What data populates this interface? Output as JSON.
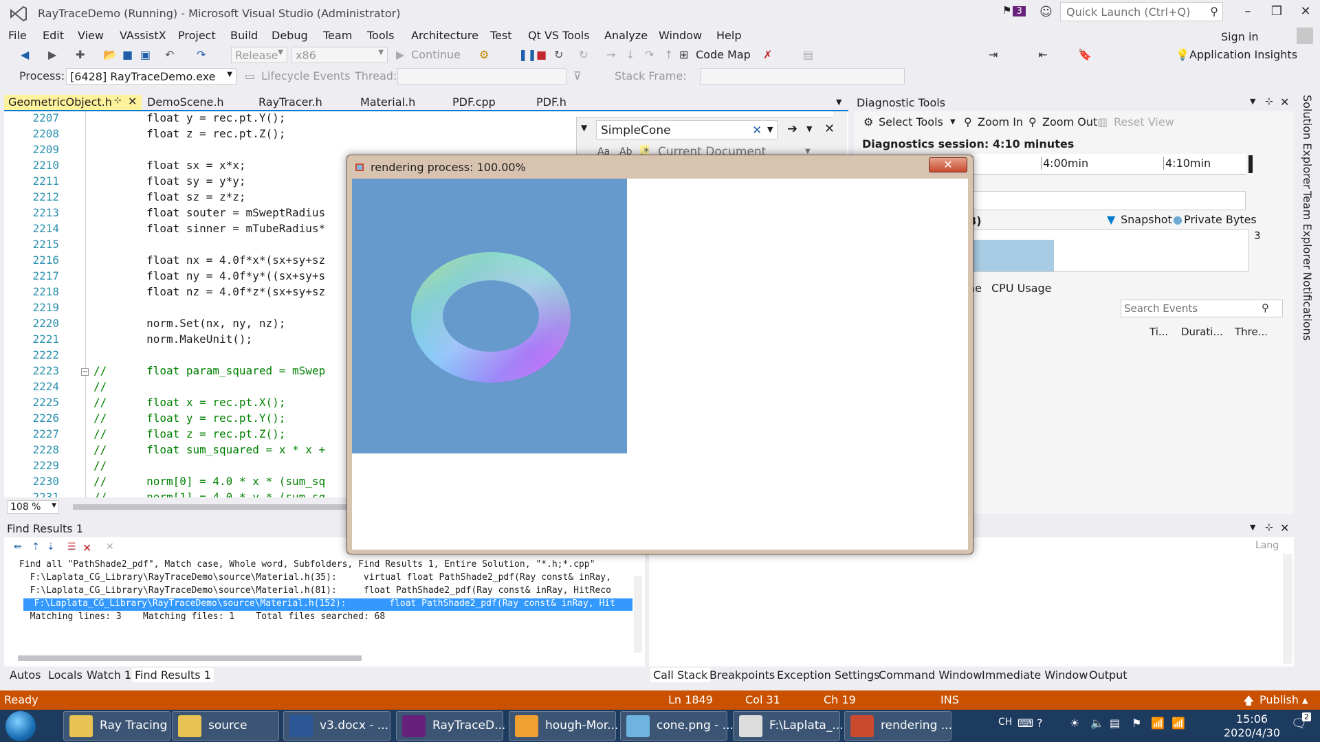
{
  "window": {
    "title": "RayTraceDemo (Running) - Microsoft Visual Studio (Administrator)",
    "notification_count": "3",
    "quick_launch_placeholder": "Quick Launch (Ctrl+Q)",
    "sign_in": "Sign in"
  },
  "menu": [
    "File",
    "Edit",
    "View",
    "VAssistX",
    "Project",
    "Build",
    "Debug",
    "Team",
    "Tools",
    "Architecture",
    "Test",
    "Qt VS Tools",
    "Analyze",
    "Window",
    "Help"
  ],
  "toolbar": {
    "config": "Release",
    "platform": "x86",
    "continue": "Continue",
    "code_map": "Code Map",
    "app_insights": "Application Insights"
  },
  "procbar": {
    "process_label": "Process:",
    "process_value": "[6428] RayTraceDemo.exe",
    "lifecycle": "Lifecycle Events",
    "thread": "Thread:",
    "stack_frame": "Stack Frame:"
  },
  "doc_tabs": [
    "GeometricObject.h",
    "DemoScene.h",
    "RayTracer.h",
    "Material.h",
    "PDF.cpp",
    "PDF.h"
  ],
  "find": {
    "query": "SimpleCone",
    "scope": "Current Document"
  },
  "code": [
    {
      "n": "2207",
      "t": "        float y = rec.pt.Y();",
      "c": false
    },
    {
      "n": "2208",
      "t": "        float z = rec.pt.Z();",
      "c": false
    },
    {
      "n": "2209",
      "t": "",
      "c": false
    },
    {
      "n": "2210",
      "t": "        float sx = x*x;",
      "c": false
    },
    {
      "n": "2211",
      "t": "        float sy = y*y;",
      "c": false
    },
    {
      "n": "2212",
      "t": "        float sz = z*z;",
      "c": false
    },
    {
      "n": "2213",
      "t": "        float souter = mSweptRadius",
      "c": false
    },
    {
      "n": "2214",
      "t": "        float sinner = mTubeRadius*",
      "c": false
    },
    {
      "n": "2215",
      "t": "",
      "c": false
    },
    {
      "n": "2216",
      "t": "        float nx = 4.0f*x*(sx+sy+sz",
      "c": false
    },
    {
      "n": "2217",
      "t": "        float ny = 4.0f*y*((sx+sy+s",
      "c": false
    },
    {
      "n": "2218",
      "t": "        float nz = 4.0f*z*(sx+sy+sz",
      "c": false
    },
    {
      "n": "2219",
      "t": "",
      "c": false
    },
    {
      "n": "2220",
      "t": "        norm.Set(nx, ny, nz);",
      "c": false
    },
    {
      "n": "2221",
      "t": "        norm.MakeUnit();",
      "c": false
    },
    {
      "n": "2222",
      "t": "",
      "c": false
    },
    {
      "n": "2223",
      "t": "//      float param_squared = mSwep",
      "c": true
    },
    {
      "n": "2224",
      "t": "//",
      "c": true
    },
    {
      "n": "2225",
      "t": "//      float x = rec.pt.X();",
      "c": true
    },
    {
      "n": "2226",
      "t": "//      float y = rec.pt.Y();",
      "c": true
    },
    {
      "n": "2227",
      "t": "//      float z = rec.pt.Z();",
      "c": true
    },
    {
      "n": "2228",
      "t": "//      float sum_squared = x * x +",
      "c": true
    },
    {
      "n": "2229",
      "t": "//",
      "c": true
    },
    {
      "n": "2230",
      "t": "//      norm[0] = 4.0 * x * (sum_sq",
      "c": true
    },
    {
      "n": "2231",
      "t": "//      norm[1] = 4.0 * y * (sum_sq",
      "c": true
    }
  ],
  "zoom": "108 %",
  "diagnostics": {
    "title": "Diagnostic Tools",
    "select_tools": "Select Tools",
    "zoom_in": "Zoom In",
    "zoom_out": "Zoom Out",
    "reset_view": "Reset View",
    "session": "Diagnostics session: 4:10 minutes",
    "tick1": "4:00min",
    "tick2": "4:10min",
    "mem_unit": "B)",
    "snapshot": "Snapshot",
    "private_bytes": "Private Bytes",
    "axis_max": "3",
    "events_tab": "ne",
    "cpu_tab": "CPU Usage",
    "search_events": "Search Events",
    "col_time": "Ti...",
    "col_duration": "Durati...",
    "col_thread": "Thre..."
  },
  "dialog": {
    "title": "rendering process: 100.00%",
    "close": "✕"
  },
  "find_results": {
    "title": "Find Results 1",
    "lines": [
      "Find all \"PathShade2_pdf\", Match case, Whole word, Subfolders, Find Results 1, Entire Solution, \"*.h;*.cpp\"",
      "  F:\\Laplata_CG_Library\\RayTraceDemo\\source\\Material.h(35):     virtual float PathShade2_pdf(Ray const& inRay,",
      "  F:\\Laplata_CG_Library\\RayTraceDemo\\source\\Material.h(81):     float PathShade2_pdf(Ray const& inRay, HitReco",
      "  F:\\Laplata_CG_Library\\RayTraceDemo\\source\\Material.h(152):        float PathShade2_pdf(Ray const& inRay, Hit",
      "  Matching lines: 3    Matching files: 1    Total files searched: 68"
    ]
  },
  "output_lang": "Lang",
  "bottom_tabs_left": [
    "Autos",
    "Locals",
    "Watch 1",
    "Find Results 1"
  ],
  "bottom_tabs_right": [
    "Call Stack",
    "Breakpoints",
    "Exception Settings",
    "Command Window",
    "Immediate Window",
    "Output"
  ],
  "side_tabs": [
    "Solution Explorer",
    "Team Explorer",
    "Notifications"
  ],
  "status": {
    "ready": "Ready",
    "ln": "Ln 1849",
    "col": "Col 31",
    "ch": "Ch 19",
    "ins": "INS",
    "publish": "Publish"
  },
  "taskbar": [
    {
      "label": "Ray Tracing",
      "icon": "folder-icon"
    },
    {
      "label": "source",
      "icon": "folder-icon"
    },
    {
      "label": "v3.docx - ...",
      "icon": "word-icon"
    },
    {
      "label": "RayTraceD...",
      "icon": "visual-studio-icon"
    },
    {
      "label": "hough-Mor...",
      "icon": "app-icon"
    },
    {
      "label": "cone.png - ...",
      "icon": "paint-icon"
    },
    {
      "label": "F:\\Laplata_...",
      "icon": "console-icon"
    },
    {
      "label": "rendering ...",
      "icon": "render-app-icon"
    }
  ],
  "tray": {
    "ime": "CH",
    "time": "15:06",
    "date": "2020/4/30",
    "notif": "2"
  }
}
